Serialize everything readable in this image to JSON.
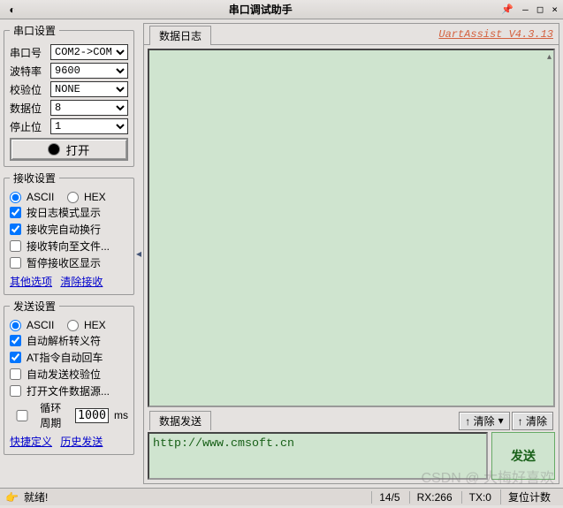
{
  "titlebar": {
    "title": "串口调试助手",
    "min": "–",
    "max": "□",
    "close": "×",
    "pin": "📌"
  },
  "portSettings": {
    "legend": "串口设置",
    "portLabel": "串口号",
    "port": "COM2->COM",
    "baudLabel": "波特率",
    "baud": "9600",
    "parityLabel": "校验位",
    "parity": "NONE",
    "dataBitsLabel": "数据位",
    "dataBits": "8",
    "stopBitsLabel": "停止位",
    "stopBits": "1",
    "openBtn": "打开"
  },
  "recvSettings": {
    "legend": "接收设置",
    "ascii": "ASCII",
    "hex": "HEX",
    "opt1": "按日志模式显示",
    "opt2": "接收完自动换行",
    "opt3": "接收转向至文件...",
    "opt4": "暂停接收区显示",
    "linkOther": "其他选项",
    "linkClear": "清除接收"
  },
  "sendSettings": {
    "legend": "发送设置",
    "ascii": "ASCII",
    "hex": "HEX",
    "opt1": "自动解析转义符",
    "opt2": "AT指令自动回车",
    "opt3": "自动发送校验位",
    "opt4": "打开文件数据源...",
    "cycleLabel": "循环周期",
    "cycleVal": "1000",
    "cycleUnit": "ms",
    "linkQuick": "快捷定义",
    "linkHist": "历史发送"
  },
  "rightPanel": {
    "logTab": "数据日志",
    "brand": "UartAssist V4.3.13",
    "sendTab": "数据发送",
    "clearDrop": "↑ 清除",
    "clearBtn": "↑ 清除",
    "sendInput": "http://www.cmsoft.cn",
    "sendBtn": "发送"
  },
  "status": {
    "ready": "就绪!",
    "pos": "14/5",
    "rx": "RX:266",
    "tx": "TX:0",
    "reset": "复位计数"
  },
  "watermark": "CSDN @ 大梅好喜欢"
}
